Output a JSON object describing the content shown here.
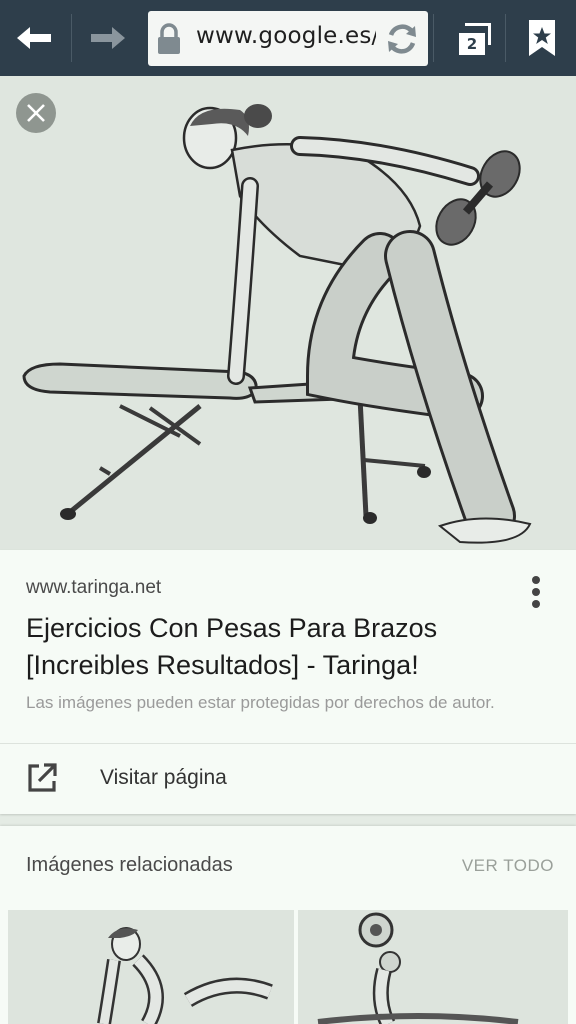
{
  "browser": {
    "url": "www.google.es/",
    "tab_count": "2",
    "icons": {
      "back": "back-arrow-icon",
      "forward": "forward-arrow-icon",
      "lock": "lock-icon",
      "reload": "reload-icon",
      "tabs": "tabs-icon",
      "bookmark": "bookmark-star-icon"
    },
    "colors": {
      "toolbar": "#2e3e4b",
      "urlbar": "#f4f6f4"
    }
  },
  "viewer": {
    "close_icon": "close-icon"
  },
  "result": {
    "domain": "www.taringa.net",
    "title": "Ejercicios Con Pesas Para Brazos [Increibles Resultados] - Taringa!",
    "copyright_note": "Las imágenes pueden estar protegidas por derechos de autor.",
    "visit_label": "Visitar página",
    "visit_icon": "open-external-icon",
    "menu_icon": "more-vertical-icon"
  },
  "related": {
    "title": "Imágenes relacionadas",
    "view_all": "VER TODO"
  }
}
